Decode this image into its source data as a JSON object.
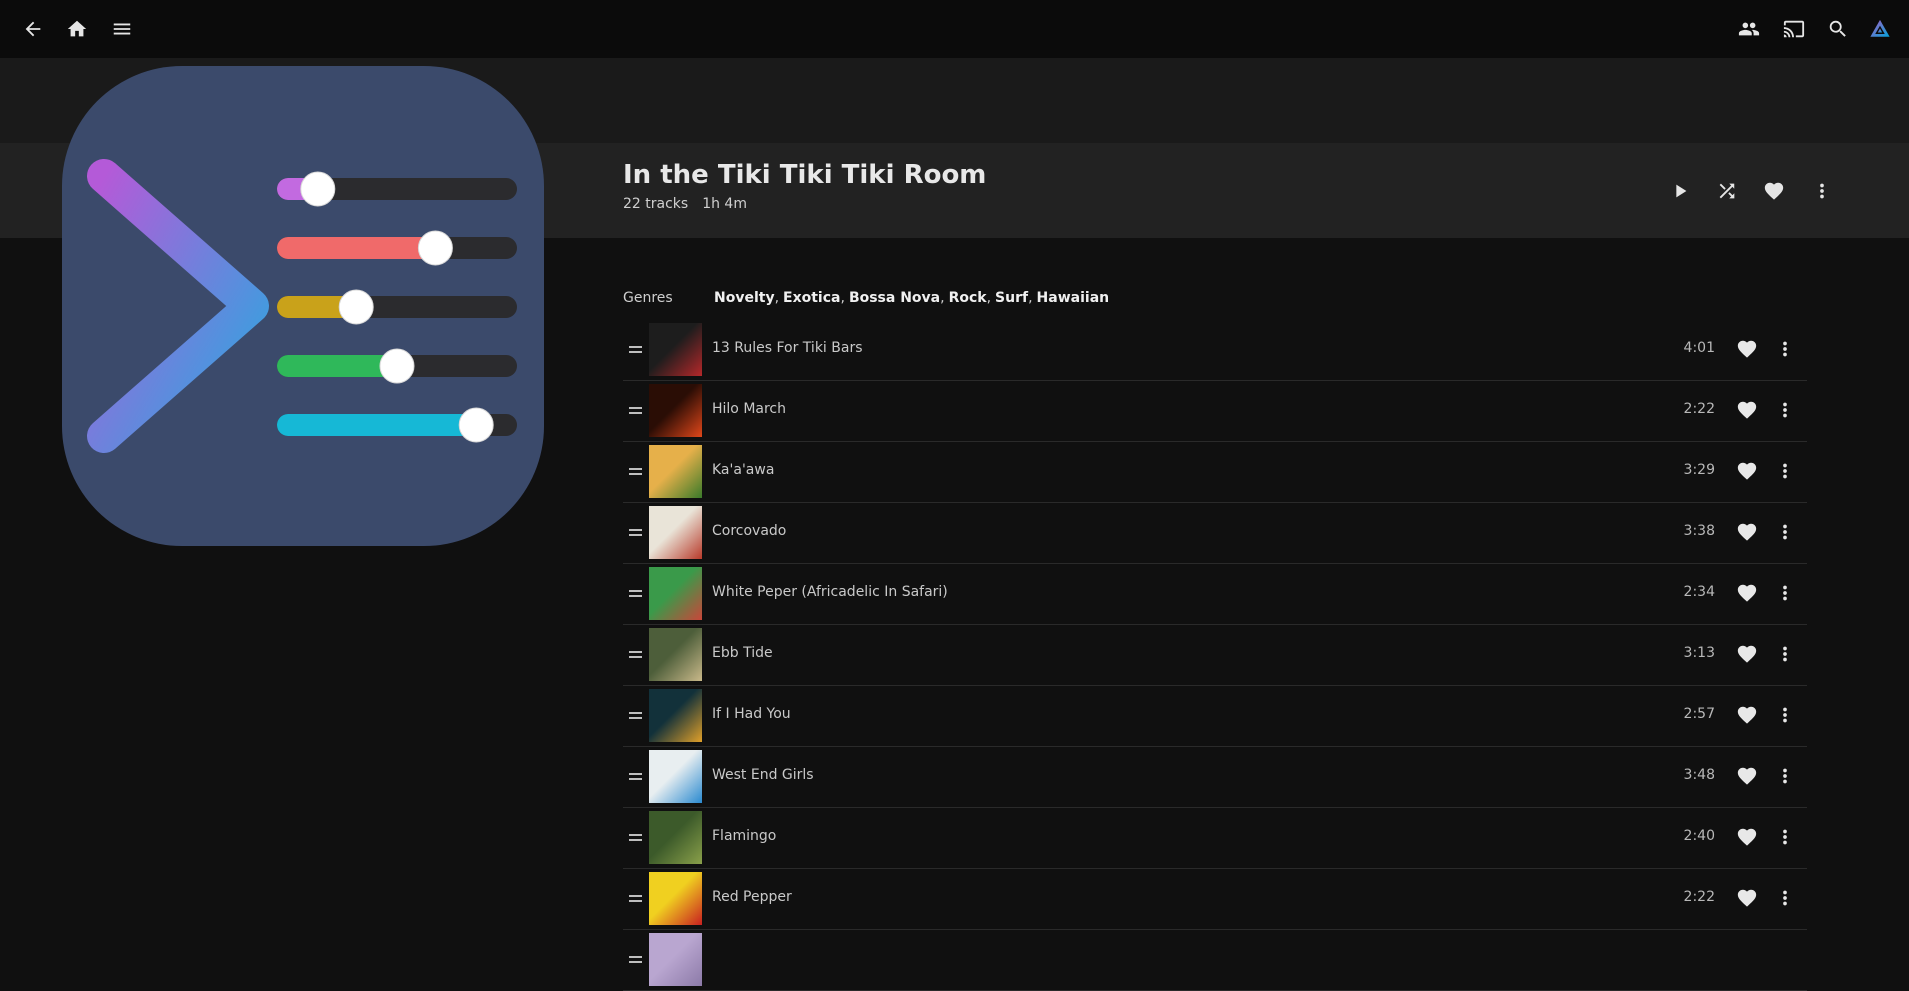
{
  "topbar": {
    "left_icons": [
      "back-arrow-icon",
      "home-icon",
      "menu-icon"
    ],
    "right_icons": [
      "sync-play-icon",
      "cast-icon",
      "search-icon",
      "jellyfin-user-icon"
    ]
  },
  "album": {
    "title": "In the Tiki Tiki Tiki Room",
    "track_count": "22 tracks",
    "runtime": "1h 4m"
  },
  "header_actions": [
    "play-icon",
    "shuffle-icon",
    "favorite-icon",
    "more-vert-icon"
  ],
  "genres": {
    "label": "Genres",
    "items": [
      "Novelty",
      "Exotica",
      "Bossa Nova",
      "Rock",
      "Surf",
      "Hawaiian"
    ]
  },
  "tracks": [
    {
      "name": "13 Rules For Tiki Bars",
      "duration": "4:01",
      "thumb": [
        "#1d1d1d",
        "#b5282a"
      ]
    },
    {
      "name": "Hilo March",
      "duration": "2:22",
      "thumb": [
        "#2a0d05",
        "#e0471a"
      ]
    },
    {
      "name": "Ka'a'awa",
      "duration": "3:29",
      "thumb": [
        "#e6b04a",
        "#3a7a2a"
      ]
    },
    {
      "name": "Corcovado",
      "duration": "3:38",
      "thumb": [
        "#e9e4d8",
        "#b83a2a"
      ]
    },
    {
      "name": "White Peper (Africadelic In Safari)",
      "duration": "2:34",
      "thumb": [
        "#3a9a4a",
        "#c9463a"
      ]
    },
    {
      "name": "Ebb Tide",
      "duration": "3:13",
      "thumb": [
        "#4d5e3a",
        "#c9b98a"
      ]
    },
    {
      "name": "If I Had You",
      "duration": "2:57",
      "thumb": [
        "#12313a",
        "#e0a02a"
      ]
    },
    {
      "name": "West End Girls",
      "duration": "3:48",
      "thumb": [
        "#e8eef0",
        "#2a8ad0"
      ]
    },
    {
      "name": "Flamingo",
      "duration": "2:40",
      "thumb": [
        "#3c5a2a",
        "#8aa04a"
      ]
    },
    {
      "name": "Red Pepper",
      "duration": "2:22",
      "thumb": [
        "#f0d020",
        "#c82020"
      ]
    },
    {
      "name": "",
      "duration": "",
      "thumb": [
        "#b9a6d0",
        "#8c7aa8"
      ]
    }
  ],
  "cover": {
    "bg": "#3b4a6b",
    "sliders": [
      {
        "color": "#c26ae0",
        "level": 0.17
      },
      {
        "color": "#f06a6a",
        "level": 0.66
      },
      {
        "color": "#c9a21a",
        "level": 0.33
      },
      {
        "color": "#2fb85a",
        "level": 0.5
      },
      {
        "color": "#16b8d6",
        "level": 0.83
      }
    ]
  }
}
